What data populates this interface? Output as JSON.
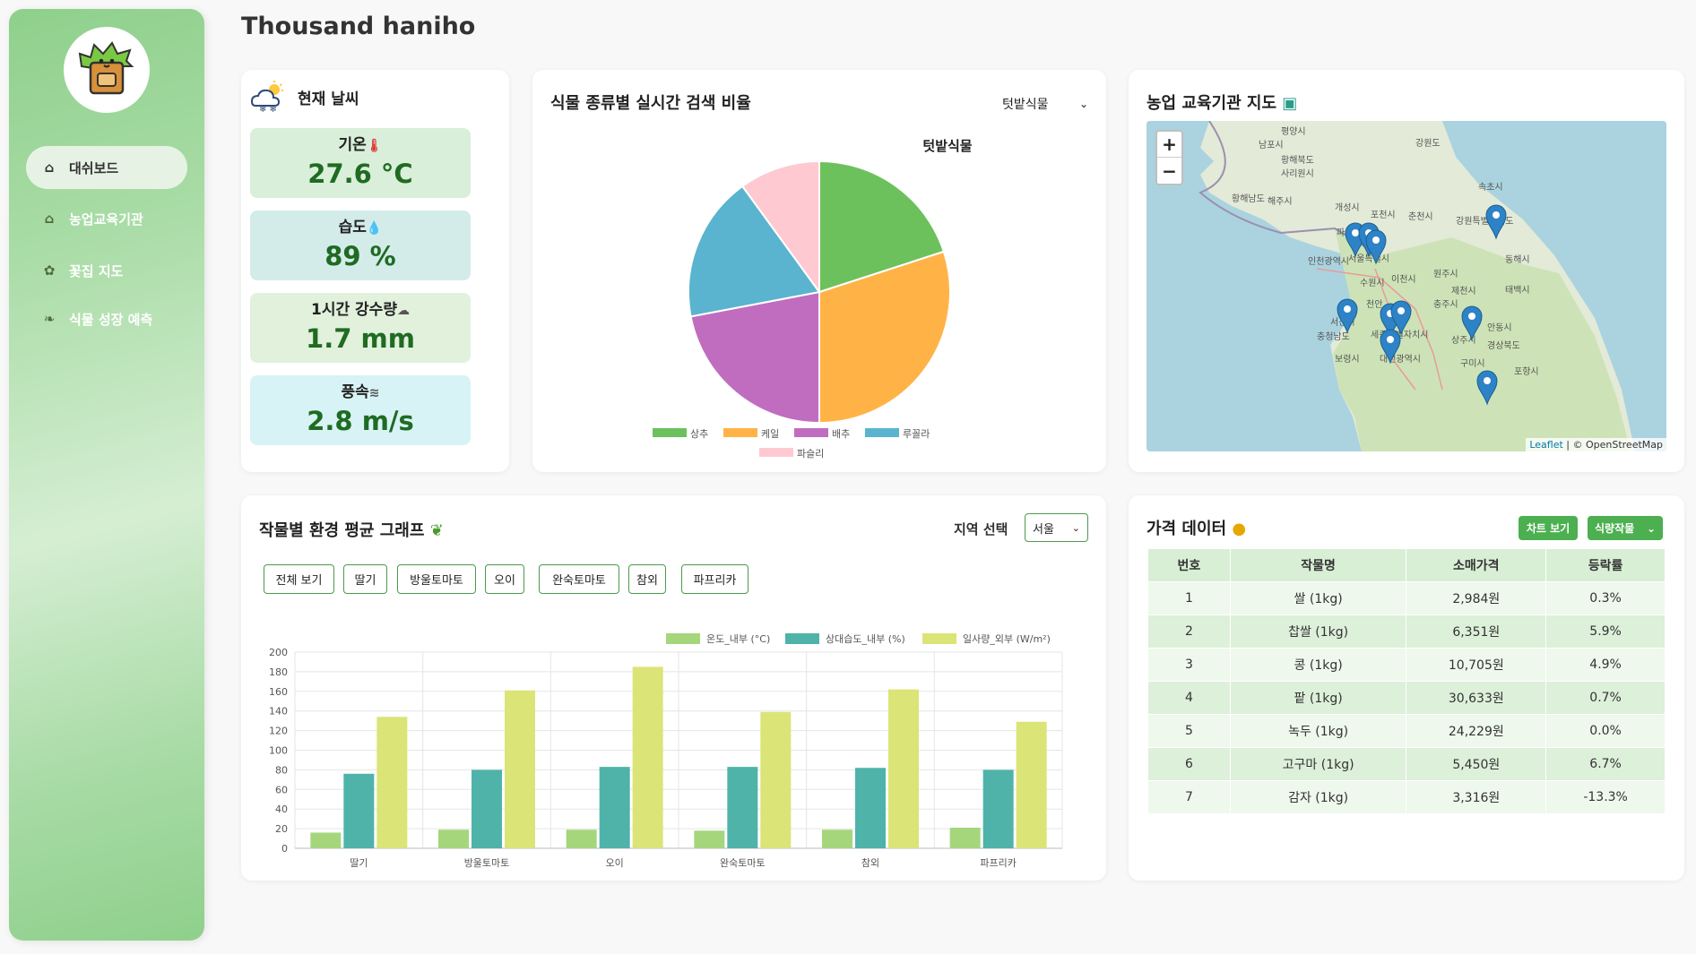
{
  "app_title": "Thousand haniho",
  "nav": [
    {
      "label": "대쉬보드",
      "icon": "home-icon",
      "active": true
    },
    {
      "label": "농업교육기관",
      "icon": "school-icon",
      "active": false
    },
    {
      "label": "꽃집 지도",
      "icon": "flower-icon",
      "active": false
    },
    {
      "label": "식물 성장 예측",
      "icon": "sprout-icon",
      "active": false
    }
  ],
  "weather": {
    "title": "현재 날씨",
    "icon": "weather-icon",
    "items": [
      {
        "label": "기온",
        "value": "27.6 °C",
        "icon": "thermometer-icon",
        "color": "#d9efd9"
      },
      {
        "label": "습도",
        "value": "89 %",
        "icon": "droplet-icon",
        "color": "#d3ecea"
      },
      {
        "label": "1시간 강수량",
        "value": "1.7 mm",
        "icon": "rain-cloud-icon",
        "color": "#e1f1dc"
      },
      {
        "label": "풍속",
        "value": "2.8 m/s",
        "icon": "wind-icon",
        "color": "#d7f3f5"
      }
    ]
  },
  "pie": {
    "title": "식물 종류별 실시간 검색 비율",
    "dropdown_value": "텃밭식물",
    "chart_title": "텃밭식물",
    "legend": [
      "상추",
      "케일",
      "배추",
      "루꼴라",
      "파슬리"
    ]
  },
  "map": {
    "title": "농업 교육기관 지도",
    "zoom_in": "+",
    "zoom_out": "−",
    "attribution_leaflet": "Leaflet",
    "attribution_osm": "| © OpenStreetMap",
    "place_labels": [
      "평양시",
      "강원도",
      "남포시",
      "황해북도",
      "사리원시",
      "해주시",
      "황해남도",
      "개성시",
      "포천시",
      "춘천시",
      "속초시",
      "파주시",
      "강원특별자치도",
      "서울특별시",
      "인천광역시",
      "수원시",
      "이천시",
      "원주시",
      "동해시",
      "제천시",
      "태백시",
      "천안",
      "충주시",
      "서산시",
      "충청남도",
      "세종특별자치시",
      "안동시",
      "상주시",
      "경상북도",
      "대전광역시",
      "보령시",
      "구미시",
      "포항시"
    ]
  },
  "bar": {
    "title": "작물별 환경 평균 그래프",
    "region_label": "지역 선택",
    "region_value": "서울",
    "filters": [
      "전체 보기",
      "딸기",
      "방울토마토",
      "오이",
      "완숙토마토",
      "참외",
      "파프리카"
    ]
  },
  "price": {
    "title": "가격 데이터",
    "chart_button": "차트 보기",
    "category_value": "식량작물",
    "columns": [
      "번호",
      "작물명",
      "소매가격",
      "등락률"
    ],
    "rows": [
      [
        "1",
        "쌀 (1kg)",
        "2,984원",
        "0.3%"
      ],
      [
        "2",
        "찹쌀 (1kg)",
        "6,351원",
        "5.9%"
      ],
      [
        "3",
        "콩 (1kg)",
        "10,705원",
        "4.9%"
      ],
      [
        "4",
        "팥 (1kg)",
        "30,633원",
        "0.7%"
      ],
      [
        "5",
        "녹두 (1kg)",
        "24,229원",
        "0.0%"
      ],
      [
        "6",
        "고구마 (1kg)",
        "5,450원",
        "6.7%"
      ],
      [
        "7",
        "감자 (1kg)",
        "3,316원",
        "-13.3%"
      ]
    ]
  },
  "chart_data": [
    {
      "type": "pie",
      "title": "텃밭식물",
      "categories": [
        "상추",
        "케일",
        "배추",
        "루꼴라",
        "파슬리"
      ],
      "values": [
        20,
        30,
        22,
        18,
        10
      ],
      "colors": [
        "#6cc15c",
        "#ffb347",
        "#c06dc0",
        "#5ab4cf",
        "#ffc9d2"
      ],
      "legend_position": "bottom"
    },
    {
      "type": "bar",
      "categories": [
        "딸기",
        "방울토마토",
        "오이",
        "완숙토마토",
        "참외",
        "파프리카"
      ],
      "series": [
        {
          "name": "온도_내부 (°C)",
          "values": [
            16,
            19,
            19,
            18,
            19,
            21
          ],
          "color": "#a5d67c"
        },
        {
          "name": "상대습도_내부 (%)",
          "values": [
            76,
            80,
            83,
            83,
            82,
            80
          ],
          "color": "#4fb3aa"
        },
        {
          "name": "일사량_외부 (W/m²)",
          "values": [
            134,
            161,
            185,
            139,
            162,
            129
          ],
          "color": "#dbe476"
        }
      ],
      "ylim": [
        0,
        200
      ],
      "yticks": [
        0,
        20,
        40,
        60,
        80,
        100,
        120,
        140,
        160,
        180,
        200
      ],
      "grid": true,
      "legend_position": "top"
    }
  ]
}
